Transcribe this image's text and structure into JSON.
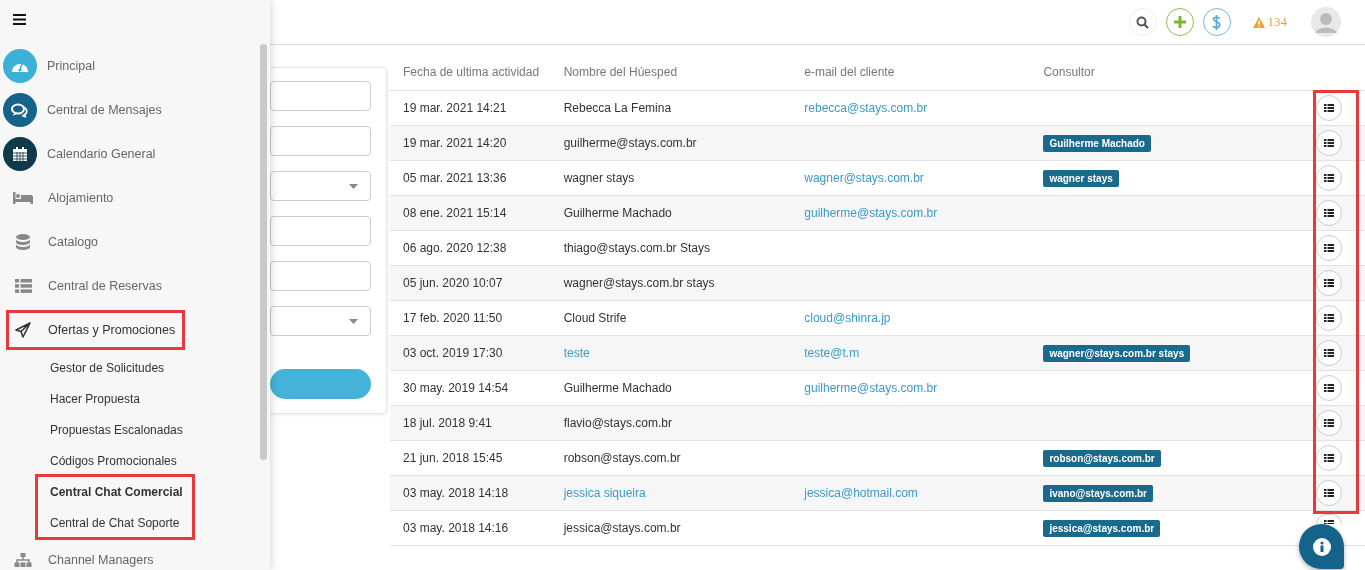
{
  "sidebar": {
    "items": [
      {
        "label": "Principal",
        "kind": "circle",
        "color": "#3cb0d8",
        "highlighted": false
      },
      {
        "label": "Central de Mensajes",
        "kind": "circle",
        "color": "#15628a",
        "highlighted": false
      },
      {
        "label": "Calendario General",
        "kind": "circle",
        "color": "#0e3a4a",
        "highlighted": false
      },
      {
        "label": "Alojamiento",
        "kind": "plain",
        "highlighted": false
      },
      {
        "label": "Catalogo",
        "kind": "plain",
        "highlighted": false
      },
      {
        "label": "Central de Reservas",
        "kind": "plain",
        "highlighted": false
      },
      {
        "label": "Ofertas y Promociones",
        "kind": "plain",
        "highlighted": true,
        "expanded": true,
        "children": [
          {
            "label": "Gestor de Solicitudes",
            "selected": false,
            "highlighted": false
          },
          {
            "label": "Hacer Propuesta",
            "selected": false,
            "highlighted": false
          },
          {
            "label": "Propuestas Escalonadas",
            "selected": false,
            "highlighted": false
          },
          {
            "label": "Códigos Promocionales",
            "selected": false,
            "highlighted": false
          },
          {
            "label": "Central Chat Comercial",
            "selected": true,
            "highlighted": true
          },
          {
            "label": "Central de Chat Soporte",
            "selected": false,
            "highlighted": true
          }
        ]
      },
      {
        "label": "Channel Managers",
        "kind": "plain",
        "highlighted": false
      }
    ]
  },
  "header": {
    "alerts": "134"
  },
  "filters": {
    "fields": [
      {
        "kind": "text"
      },
      {
        "kind": "text"
      },
      {
        "kind": "select"
      },
      {
        "kind": "text"
      },
      {
        "kind": "text"
      },
      {
        "kind": "select"
      }
    ],
    "search_button": {
      "kind": "button"
    }
  },
  "table": {
    "columns": [
      "Fecha de ultima actividad",
      "Nombre del Húesped",
      "e-mail del cliente",
      "Consultor"
    ],
    "actions_highlighted": true,
    "rows": [
      {
        "date": "19 mar. 2021 14:21",
        "name": "Rebecca La Femina",
        "name_link": false,
        "email": "rebecca@stays.com.br"
      },
      {
        "date": "19 mar. 2021 14:20",
        "name": "guilherme@stays.com.br",
        "name_link": false,
        "consultant": "Guilherme Machado"
      },
      {
        "date": "05 mar. 2021 13:36",
        "name": "wagner stays",
        "name_link": false,
        "email": "wagner@stays.com.br",
        "consultant": "wagner stays"
      },
      {
        "date": "08 ene. 2021 15:14",
        "name": "Guilherme Machado",
        "name_link": false,
        "email": "guilherme@stays.com.br"
      },
      {
        "date": "06 ago. 2020 12:38",
        "name": "thiago@stays.com.br Stays",
        "name_link": false
      },
      {
        "date": "05 jun. 2020 10:07",
        "name": "wagner@stays.com.br stays",
        "name_link": false
      },
      {
        "date": "17 feb. 2020 11:50",
        "name": "Cloud Strife",
        "name_link": false,
        "email": "cloud@shinra.jp"
      },
      {
        "date": "03 oct. 2019 17:30",
        "name": "teste",
        "name_link": true,
        "email": "teste@t.m",
        "consultant": "wagner@stays.com.br stays"
      },
      {
        "date": "30 may. 2019 14:54",
        "name": "Guilherme Machado",
        "name_link": false,
        "email": "guilherme@stays.com.br"
      },
      {
        "date": "18 jul. 2018 9:41",
        "name": "flavio@stays.com.br",
        "name_link": false
      },
      {
        "date": "21 jun. 2018 15:45",
        "name": "robson@stays.com.br",
        "name_link": false,
        "consultant": "robson@stays.com.br"
      },
      {
        "date": "03 may. 2018 14:18",
        "name": "jessica siqueira",
        "name_link": true,
        "email": "jessica@hotmail.com",
        "consultant": "ivano@stays.com.br"
      },
      {
        "date": "03 may. 2018 14:16",
        "name": "jessica@stays.com.br",
        "name_link": false,
        "consultant": "jessica@stays.com.br"
      }
    ]
  }
}
